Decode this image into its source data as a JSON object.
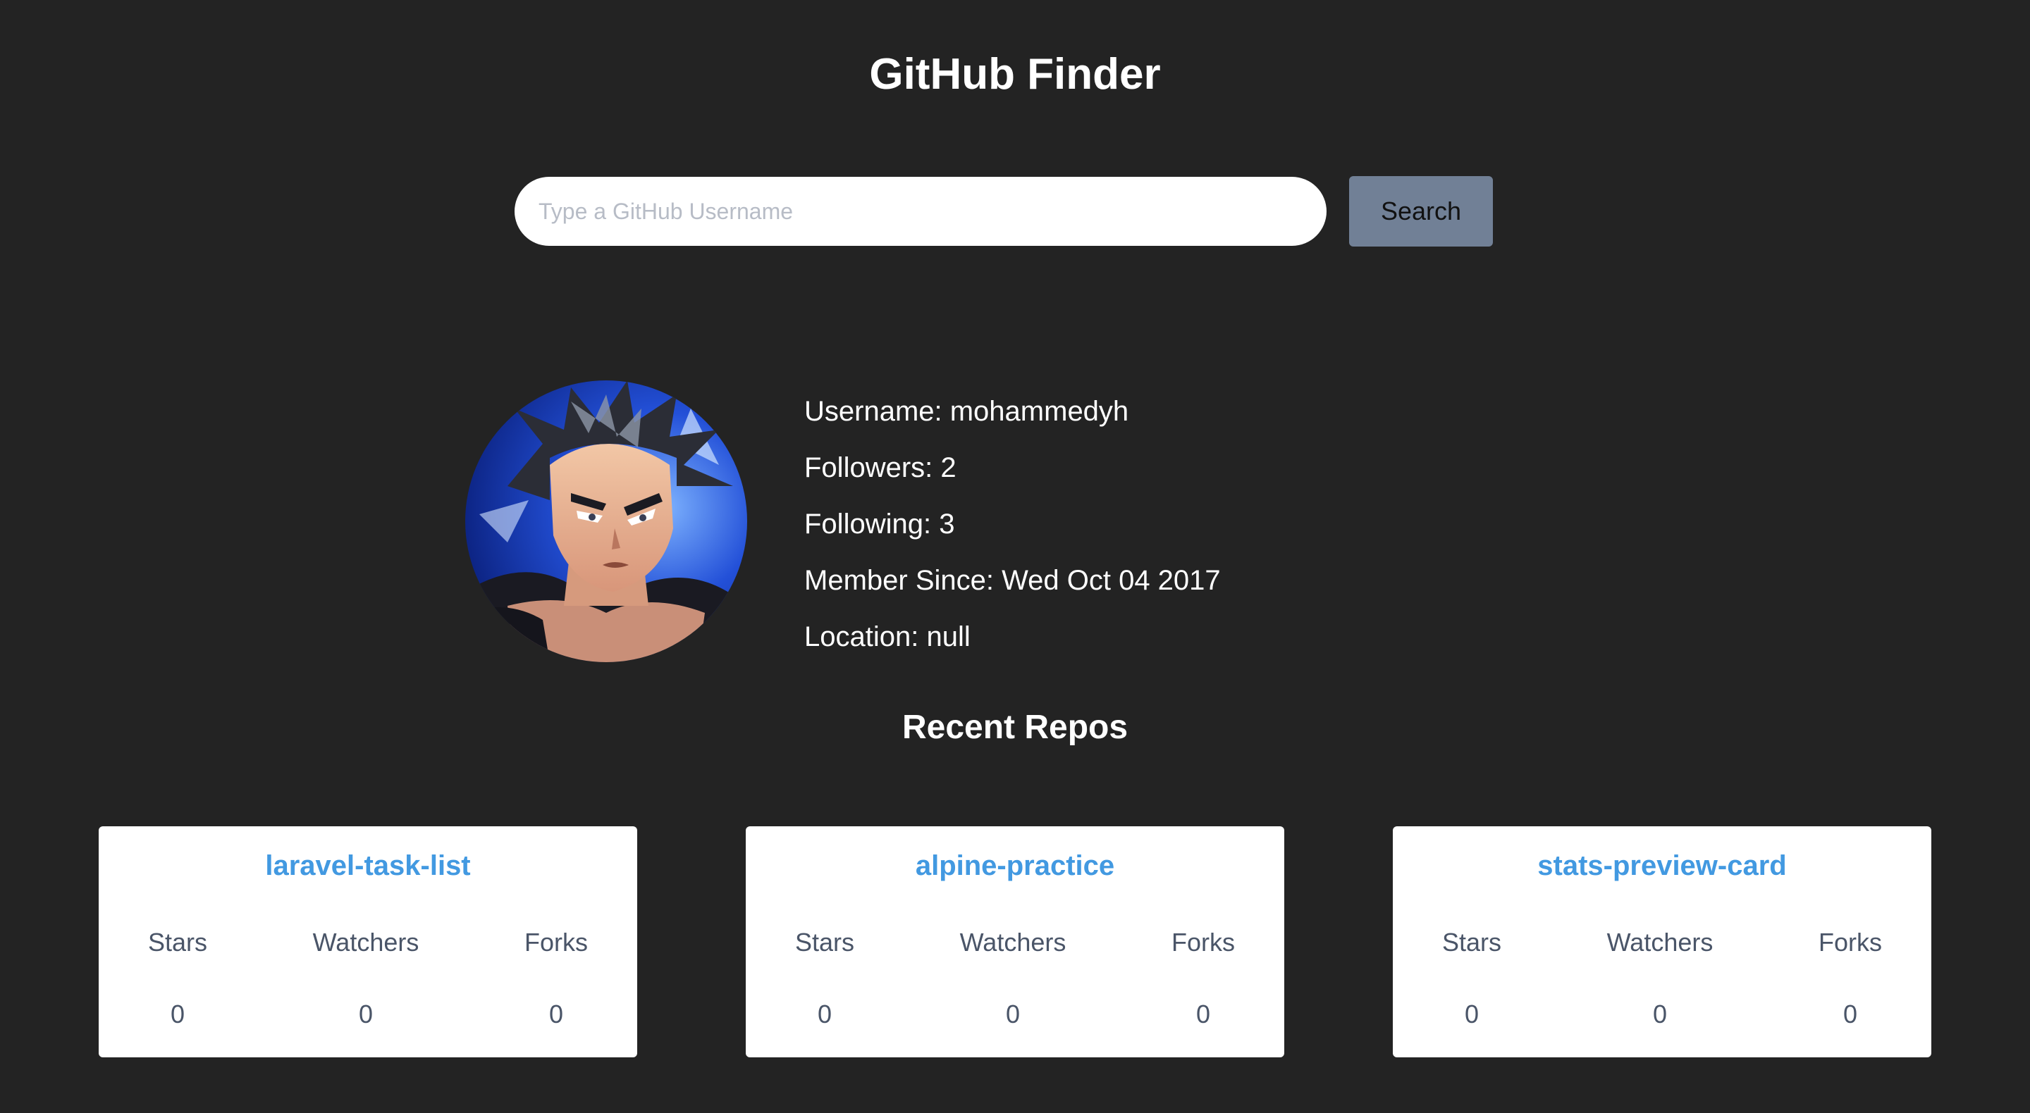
{
  "app": {
    "title": "GitHub Finder"
  },
  "search": {
    "placeholder": "Type a GitHub Username",
    "value": "",
    "button_label": "Search"
  },
  "profile": {
    "username": "Username: mohammedyh",
    "followers": "Followers: 2",
    "following": "Following: 3",
    "member_since": "Member Since: Wed Oct 04 2017",
    "location": "Location: null"
  },
  "repos_section": {
    "title": "Recent Repos",
    "stat_labels": {
      "stars": "Stars",
      "watchers": "Watchers",
      "forks": "Forks"
    },
    "repos": [
      {
        "name": "laravel-task-list",
        "stars": "0",
        "watchers": "0",
        "forks": "0"
      },
      {
        "name": "alpine-practice",
        "stars": "0",
        "watchers": "0",
        "forks": "0"
      },
      {
        "name": "stats-preview-card",
        "stars": "0",
        "watchers": "0",
        "forks": "0"
      }
    ]
  },
  "colors": {
    "background": "#232323",
    "button": "#718096",
    "repo_link": "#4299e1",
    "card": "#ffffff"
  },
  "icons": {
    "avatar": "user-avatar-image"
  }
}
